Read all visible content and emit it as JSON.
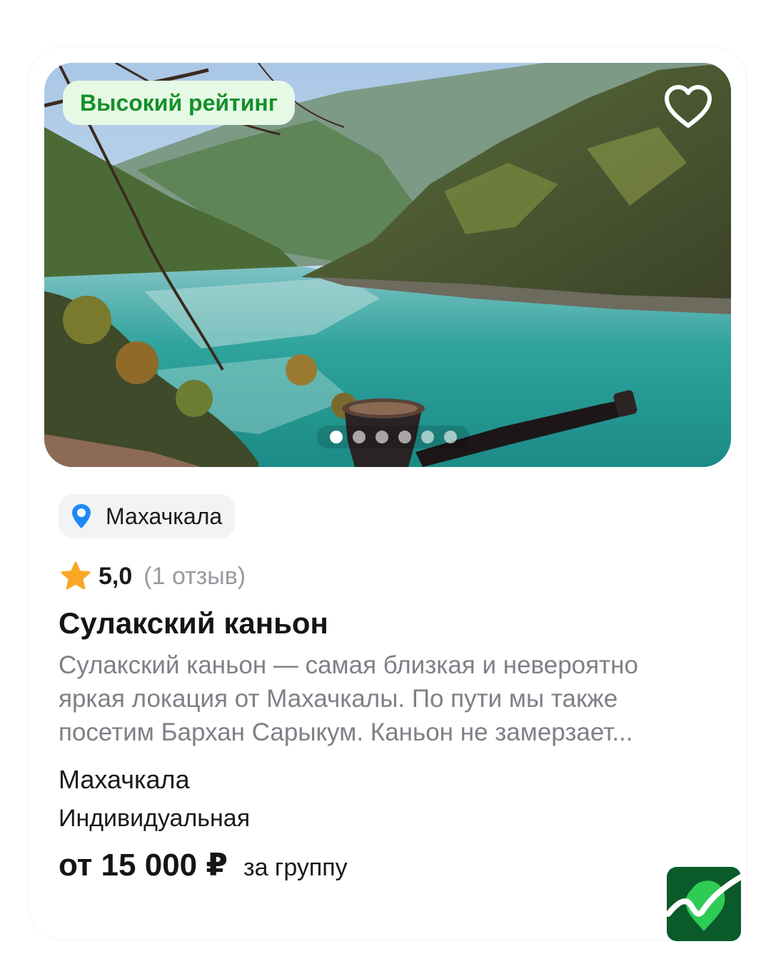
{
  "listing": {
    "badge": "Высокий рейтинг",
    "favorite_icon": "heart-outline-icon",
    "gallery": {
      "total": 6,
      "active_index": 0
    },
    "location_chip": {
      "icon": "map-pin-icon",
      "label": "Махачкала"
    },
    "rating": {
      "icon": "star-icon",
      "value": "5,0",
      "reviews": "(1 отзыв)"
    },
    "title": "Сулакский каньон",
    "description_lines": [
      "Сулакский каньон — самая близкая и невероятно",
      "яркая локация от Махачкалы. По пути мы также",
      "посетим Бархан Сарыкум. Каньон не замерзает..."
    ],
    "city": "Махачкала",
    "format": "Индивидуальная",
    "price": "от 15 000 ₽",
    "price_unit": "за группу"
  },
  "logo": {
    "icon": "app-logo-icon"
  },
  "colors": {
    "badge_bg": "#e5f9e4",
    "badge_text": "#14902b",
    "pin": "#1e88f5",
    "star": "#f9a825",
    "logo_green": "#0b5a2a"
  }
}
